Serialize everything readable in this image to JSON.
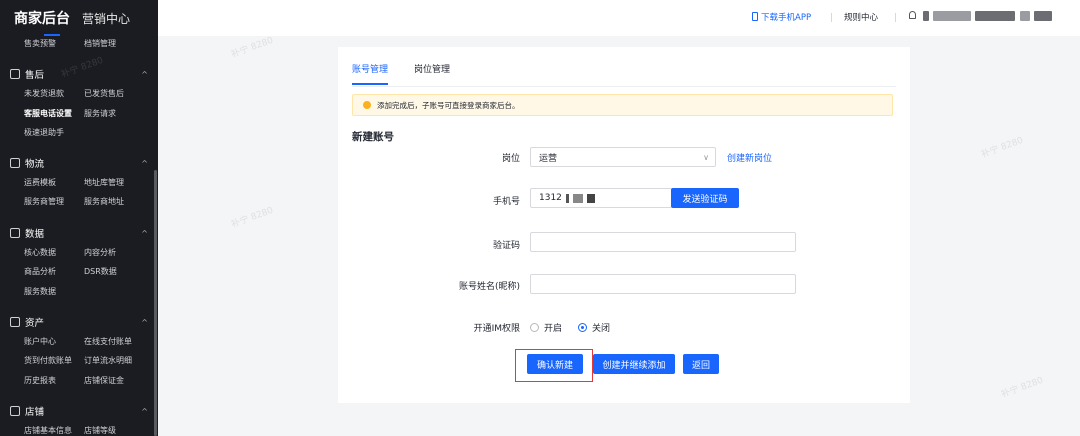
{
  "sidebar": {
    "brand_title": "商家后台",
    "brand_sub": "营销中心",
    "top_items": [
      "售卖预警",
      "档销管理"
    ],
    "sections": [
      {
        "title": "售后",
        "items": [
          [
            "未发货退款",
            "已发货售后"
          ],
          [
            "客服电话设置",
            "服务请求"
          ],
          [
            "极速退助手"
          ]
        ]
      },
      {
        "title": "物流",
        "items": [
          [
            "运费模板",
            "地址库管理"
          ],
          [
            "服务商管理",
            "服务商地址"
          ]
        ]
      },
      {
        "title": "数据",
        "items": [
          [
            "核心数据",
            "内容分析"
          ],
          [
            "商品分析",
            "DSR数据"
          ],
          [
            "服务数据"
          ]
        ]
      },
      {
        "title": "资产",
        "items": [
          [
            "账户中心",
            "在线支付账单"
          ],
          [
            "货到付款账单",
            "订单流水明细"
          ],
          [
            "历史报表",
            "店铺保证金"
          ]
        ]
      },
      {
        "title": "店铺",
        "items": [
          [
            "店铺基本信息",
            "店铺等级"
          ]
        ]
      }
    ]
  },
  "topbar": {
    "download_app": "下载手机APP",
    "rules_center": "规则中心"
  },
  "tabs": [
    "账号管理",
    "岗位管理"
  ],
  "notice": "添加完成后，子账号可直接登录商家后台。",
  "section_title": "新建账号",
  "form": {
    "position_label": "岗位",
    "position_value": "运营",
    "create_position_link": "创建新岗位",
    "phone_label": "手机号",
    "phone_value": "1312",
    "send_code_button": "发送验证码",
    "code_label": "验证码",
    "code_value": "",
    "name_label": "账号姓名(昵称)",
    "name_value": "",
    "im_label": "开通IM权限",
    "im_on": "开启",
    "im_off": "关闭"
  },
  "buttons": {
    "confirm": "确认新建",
    "create_continue": "创建并继续添加",
    "back": "返回"
  },
  "colors": {
    "primary": "#1966ff",
    "sidebar_bg": "#1b1c21",
    "highlight": "#e03a3a"
  }
}
